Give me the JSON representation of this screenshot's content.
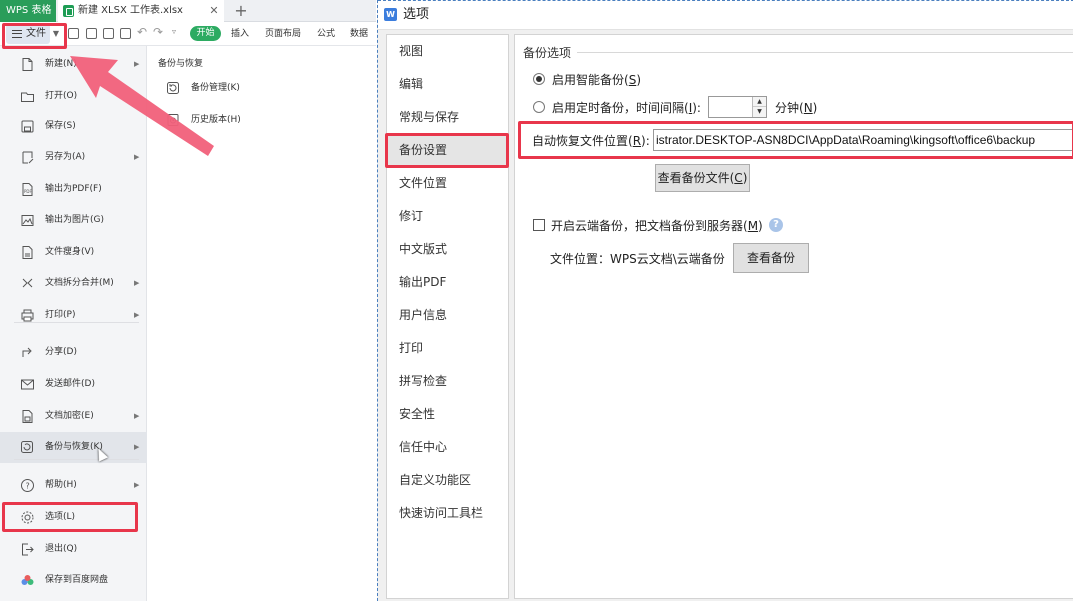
{
  "tabs": {
    "app_label": "WPS 表格",
    "document_label": "新建 XLSX 工作表.xlsx",
    "close_glyph": "✕",
    "add_glyph": "+"
  },
  "toolbar": {
    "file_label": "文件",
    "start_label": "开始",
    "ribbon_tabs": [
      "插入",
      "页面布局",
      "公式",
      "数据"
    ]
  },
  "file_menu": {
    "items": [
      {
        "label": "新建(N)",
        "icon": "new-file-icon",
        "has_submenu": true
      },
      {
        "label": "打开(O)",
        "icon": "folder-icon",
        "has_submenu": false
      },
      {
        "label": "保存(S)",
        "icon": "save-icon",
        "has_submenu": false
      },
      {
        "label": "另存为(A)",
        "icon": "save-as-icon",
        "has_submenu": true
      },
      {
        "label": "输出为PDF(F)",
        "icon": "pdf-icon",
        "has_submenu": false
      },
      {
        "label": "输出为图片(G)",
        "icon": "image-icon",
        "has_submenu": false
      },
      {
        "label": "文件瘦身(V)",
        "icon": "slim-file-icon",
        "has_submenu": false
      },
      {
        "label": "文档拆分合并(M)",
        "icon": "split-merge-icon",
        "has_submenu": true
      },
      {
        "label": "打印(P)",
        "icon": "printer-icon",
        "has_submenu": true
      },
      {
        "label": "分享(D)",
        "icon": "share-icon",
        "has_submenu": false
      },
      {
        "label": "发送邮件(D)",
        "icon": "mail-icon",
        "has_submenu": false
      },
      {
        "label": "文档加密(E)",
        "icon": "lock-icon",
        "has_submenu": true
      },
      {
        "label": "备份与恢复(K)",
        "icon": "backup-icon",
        "has_submenu": true
      },
      {
        "label": "帮助(H)",
        "icon": "help-icon",
        "has_submenu": true
      },
      {
        "label": "选项(L)",
        "icon": "gear-icon",
        "has_submenu": false
      },
      {
        "label": "退出(Q)",
        "icon": "exit-icon",
        "has_submenu": false
      },
      {
        "label": "保存到百度网盘",
        "icon": "cloud-icon",
        "has_submenu": false
      }
    ]
  },
  "submenu": {
    "title": "备份与恢复",
    "items": [
      {
        "label": "备份管理(K)",
        "icon": "backup-manage-icon"
      },
      {
        "label": "历史版本(H)",
        "icon": "history-icon"
      }
    ]
  },
  "dialog": {
    "title": "选项",
    "logo_glyph": "W",
    "nav": [
      "视图",
      "编辑",
      "常规与保存",
      "备份设置",
      "文件位置",
      "修订",
      "中文版式",
      "输出PDF",
      "用户信息",
      "打印",
      "拼写检查",
      "安全性",
      "信任中心",
      "自定义功能区",
      "快速访问工具栏"
    ],
    "active_nav": "备份设置",
    "backup": {
      "group_title": "备份选项",
      "smart_backup_label": "启用智能备份(",
      "smart_backup_key": "S",
      "timed_backup_label": "启用定时备份，时间间隔(",
      "timed_backup_key": "I",
      "interval_value": "",
      "minutes_label": "分钟(",
      "minutes_key": "N",
      "autorecover_label": "自动恢复文件位置(",
      "autorecover_key": "R",
      "autorecover_path": "istrator.DESKTOP-ASN8DCI\\AppData\\Roaming\\kingsoft\\office6\\backup",
      "view_backup_files_label": "查看备份文件(",
      "view_backup_files_key": "C",
      "cloud_backup_label": "开启云端备份，把文档备份到服务器(",
      "cloud_backup_key": "M",
      "file_location_label": "文件位置：WPS云文档\\云端备份",
      "view_backup_label": "查看备份",
      "help_glyph": "?"
    }
  },
  "colors": {
    "highlight": "#e8364b",
    "wps_green": "#2a9d5a",
    "arrow": "#f1607a"
  }
}
